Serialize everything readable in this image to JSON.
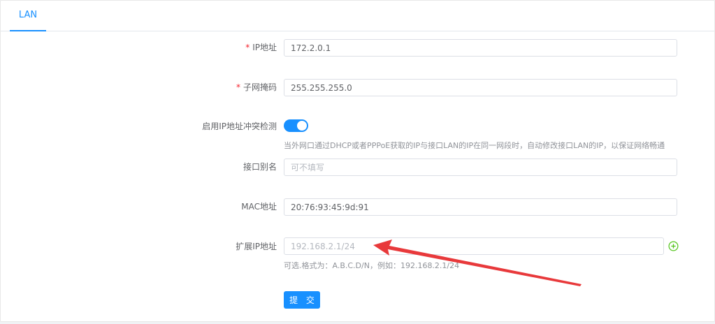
{
  "tabs": [
    {
      "label": "LAN",
      "active": true
    }
  ],
  "form": {
    "ip": {
      "required_mark": "*",
      "label": "IP地址",
      "value": "172.2.0.1"
    },
    "netmask": {
      "required_mark": "*",
      "label": "子网掩码",
      "value": "255.255.255.0"
    },
    "conflict_detect": {
      "label": "启用IP地址冲突检测",
      "enabled": true,
      "hint": "当外网口通过DHCP或者PPPoE获取的IP与接口LAN的IP在同一网段时，自动修改接口LAN的IP，以保证网络畅通"
    },
    "alias": {
      "label": "接口别名",
      "value": "",
      "placeholder": "可不填写"
    },
    "mac": {
      "label": "MAC地址",
      "value": "20:76:93:45:9d:91"
    },
    "ext_ip": {
      "label": "扩展IP地址",
      "value": "",
      "placeholder": "192.168.2.1/24",
      "hint": "可选.格式为：A.B.C.D/N，例如：192.168.2.1/24"
    },
    "submit_label": "提 交"
  },
  "colors": {
    "primary": "#1890ff",
    "required": "#f5222d",
    "add": "#52c41a",
    "annotation_arrow": "#e8393b"
  },
  "icons": {
    "add": "plus-circle-icon"
  }
}
